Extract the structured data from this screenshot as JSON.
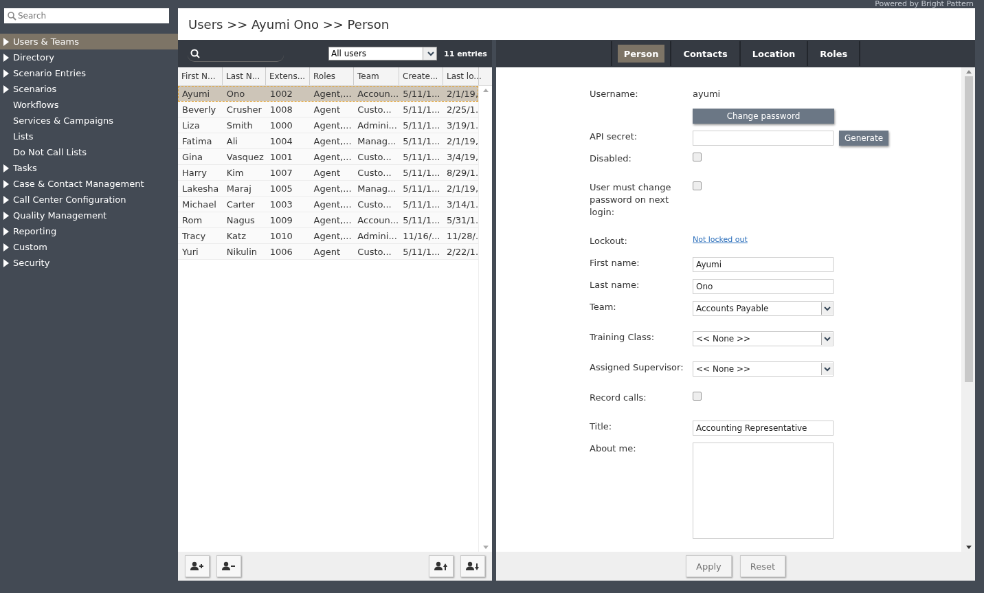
{
  "sidebar": {
    "search_placeholder": "Search",
    "items": [
      {
        "label": "Users & Teams",
        "expandable": true,
        "selected": true
      },
      {
        "label": "Directory",
        "expandable": true,
        "selected": false
      },
      {
        "label": "Scenario Entries",
        "expandable": true,
        "selected": false
      },
      {
        "label": "Scenarios",
        "expandable": true,
        "selected": false
      },
      {
        "label": "Workflows",
        "expandable": false,
        "selected": false
      },
      {
        "label": "Services & Campaigns",
        "expandable": false,
        "selected": false
      },
      {
        "label": "Lists",
        "expandable": false,
        "selected": false
      },
      {
        "label": "Do Not Call Lists",
        "expandable": false,
        "selected": false
      },
      {
        "label": "Tasks",
        "expandable": true,
        "selected": false
      },
      {
        "label": "Case & Contact Management",
        "expandable": true,
        "selected": false
      },
      {
        "label": "Call Center Configuration",
        "expandable": true,
        "selected": false
      },
      {
        "label": "Quality Management",
        "expandable": true,
        "selected": false
      },
      {
        "label": "Reporting",
        "expandable": true,
        "selected": false
      },
      {
        "label": "Custom",
        "expandable": true,
        "selected": false
      },
      {
        "label": "Security",
        "expandable": true,
        "selected": false
      }
    ]
  },
  "powered_by": "Powered by Bright Pattern",
  "breadcrumb": "Users >> Ayumi Ono >> Person",
  "list": {
    "filter": "All users",
    "count": "11 entries",
    "columns": [
      "First N...",
      "Last N...",
      "Extens...",
      "Roles",
      "Team",
      "Create...",
      "Last lo..."
    ],
    "rows": [
      {
        "cells": [
          "Ayumi",
          "Ono",
          "1002",
          "Agent,...",
          "Accoun...",
          "5/11/1...",
          "2/1/19,"
        ],
        "selected": true
      },
      {
        "cells": [
          "Beverly",
          "Crusher",
          "1008",
          "Agent",
          "Custo...",
          "5/11/1...",
          "2/25/1."
        ],
        "selected": false
      },
      {
        "cells": [
          "Liza",
          "Smith",
          "1000",
          "Agent,...",
          "Admini...",
          "5/11/1...",
          "3/19/1."
        ],
        "selected": false
      },
      {
        "cells": [
          "Fatima",
          "Ali",
          "1004",
          "Agent,...",
          "Manag...",
          "5/11/1...",
          "2/1/19,"
        ],
        "selected": false
      },
      {
        "cells": [
          "Gina",
          "Vasquez",
          "1001",
          "Agent,...",
          "Custo...",
          "5/11/1...",
          "3/4/19,"
        ],
        "selected": false
      },
      {
        "cells": [
          "Harry",
          "Kim",
          "1007",
          "Agent",
          "Custo...",
          "5/11/1...",
          "8/29/1."
        ],
        "selected": false
      },
      {
        "cells": [
          "Lakesha",
          "Maraj",
          "1005",
          "Agent,...",
          "Manag...",
          "5/11/1...",
          "2/1/19,"
        ],
        "selected": false
      },
      {
        "cells": [
          "Michael",
          "Carter",
          "1003",
          "Agent,...",
          "Custo...",
          "5/11/1...",
          "3/14/1."
        ],
        "selected": false
      },
      {
        "cells": [
          "Rom",
          "Nagus",
          "1009",
          "Agent,...",
          "Accoun...",
          "5/11/1...",
          "5/31/1."
        ],
        "selected": false
      },
      {
        "cells": [
          "Tracy",
          "Katz",
          "1010",
          "Agent,...",
          "Admini...",
          "11/16/...",
          "11/28/."
        ],
        "selected": false
      },
      {
        "cells": [
          "Yuri",
          "Nikulin",
          "1006",
          "Agent",
          "Custo...",
          "5/11/1...",
          "2/22/1."
        ],
        "selected": false
      }
    ]
  },
  "tabs": [
    {
      "label": "Person",
      "selected": true
    },
    {
      "label": "Contacts",
      "selected": false
    },
    {
      "label": "Location",
      "selected": false
    },
    {
      "label": "Roles",
      "selected": false
    }
  ],
  "form": [
    {
      "kind": "text",
      "label": "Username:",
      "value": "ayumi"
    },
    {
      "kind": "button",
      "button": "Change password"
    },
    {
      "kind": "input",
      "label": "API secret:",
      "button": "Generate"
    },
    {
      "kind": "checkbox",
      "label": "Disabled:",
      "checked": false
    },
    {
      "kind": "checkbox",
      "label": "User must change password on next login:",
      "checked": false
    },
    {
      "kind": "link",
      "label": "Lockout:",
      "value": "Not locked out"
    },
    {
      "kind": "input",
      "label": "First name:",
      "value": "Ayumi"
    },
    {
      "kind": "input",
      "label": "Last name:",
      "value": "Ono"
    },
    {
      "kind": "select",
      "label": "Team:",
      "value": "Accounts Payable"
    },
    {
      "kind": "select",
      "label": "Training Class:",
      "value": "<< None >>"
    },
    {
      "kind": "select",
      "label": "Assigned Supervisor:",
      "value": "<< None >>"
    },
    {
      "kind": "checkbox",
      "label": "Record calls:",
      "checked": false
    },
    {
      "kind": "input",
      "label": "Title:",
      "value": "Accounting Representative"
    },
    {
      "kind": "textarea",
      "label": "About me:"
    }
  ],
  "actions": [
    "Apply",
    "Reset"
  ]
}
